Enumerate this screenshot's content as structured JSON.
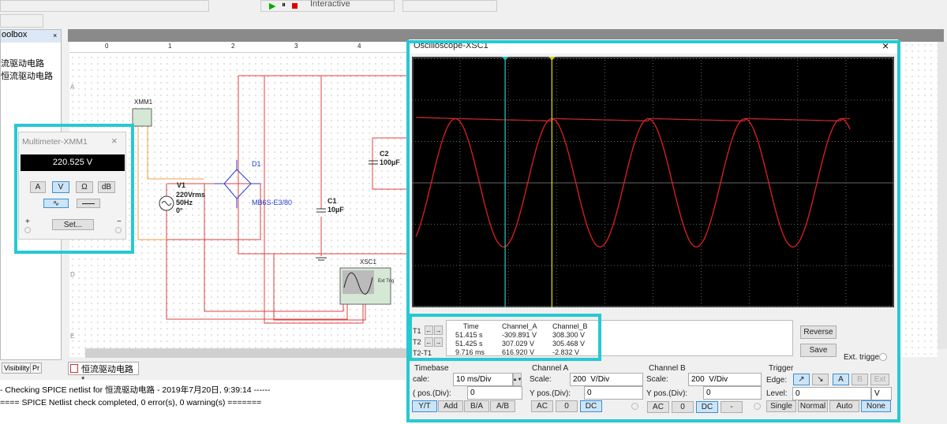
{
  "toolbar": {
    "sim_mode": "Interactive"
  },
  "toolbox": {
    "title": "oolbox",
    "items": [
      "流驱动电路",
      "恒流驱动电路"
    ],
    "tabs": [
      "Visibility",
      "Pr"
    ]
  },
  "ruler": {
    "cols": [
      "0",
      "1",
      "2",
      "3",
      "4"
    ],
    "rows": [
      "A",
      "D",
      "E"
    ]
  },
  "circuit": {
    "xmm": "XMM1",
    "d1": "D1",
    "d1_part": "MB6S-E3/80",
    "v1": "V1",
    "v1_v": "220Vrms",
    "v1_f": "50Hz",
    "v1_p": "0°",
    "c1": "C1",
    "c1_v": "10µF",
    "c2": "C2",
    "c2_v": "100µF",
    "xsc": "XSC1",
    "ext_trig": "Ext Trig"
  },
  "doc_tab": "恒流驱动电路 *",
  "log": [
    "- Checking SPICE netlist for 恒流驱动电路 - 2019年7月20日, 9:39:14 ------",
    "==== SPICE Netlist check completed, 0 error(s), 0 warning(s) ======="
  ],
  "multimeter": {
    "title": "Multimeter-XMM1",
    "reading": "220.525 V",
    "modes": [
      "A",
      "V",
      "Ω",
      "dB"
    ],
    "active_mode": "V",
    "set_label": "Set...",
    "plus": "+",
    "minus": "−"
  },
  "scope": {
    "title": "Oscilloscope-XSC1",
    "colors": {
      "channel_a": "#e02020",
      "channel_b": "#c02828",
      "t1": "#20c0c0",
      "t2": "#d0d020"
    },
    "trace": {
      "timebase_ms_per_div": 10,
      "volts_per_div": 200,
      "ch_a_amplitude_v": 310,
      "ch_a_freq_hz": 50,
      "ch_b_level_v": 305,
      "t1_div": 1.9,
      "t2_div": 2.87
    },
    "readout": {
      "headers": [
        "Time",
        "Channel_A",
        "Channel_B"
      ],
      "rows": [
        {
          "label": "T1",
          "time": "51.415 s",
          "a": "-309.891 V",
          "b": "308.300 V"
        },
        {
          "label": "T2",
          "time": "51.425 s",
          "a": "307.029 V",
          "b": "305.468 V"
        },
        {
          "label": "T2-T1",
          "time": "9.716 ms",
          "a": "616.920 V",
          "b": "-2.832 V"
        }
      ]
    },
    "reverse": "Reverse",
    "save": "Save",
    "ext_trigger": "Ext. trigger",
    "timebase": {
      "title": "Timebase",
      "scale_label": "cale:",
      "scale": "10 ms/Div",
      "xpos_label": "( pos.(Div):",
      "xpos": "0",
      "modes": [
        "Y/T",
        "Add",
        "B/A",
        "A/B"
      ],
      "active": "Y/T"
    },
    "channel_a": {
      "title": "Channel A",
      "scale_label": "Scale:",
      "scale": "200  V/Div",
      "ypos_label": "Y pos.(Div):",
      "ypos": "0",
      "coupling": [
        "AC",
        "0",
        "DC"
      ],
      "active": "DC"
    },
    "channel_b": {
      "title": "Channel B",
      "scale_label": "Scale:",
      "scale": "200  V/Div",
      "ypos_label": "Y pos.(Div):",
      "ypos": "0",
      "coupling": [
        "AC",
        "0",
        "DC",
        "-"
      ],
      "active": "DC"
    },
    "trigger": {
      "title": "Trigger",
      "edge_label": "Edge:",
      "edges": [
        "↗",
        "↘"
      ],
      "sources": [
        "A",
        "B",
        "Ext"
      ],
      "level_label": "Level:",
      "level": "0",
      "level_unit": "V",
      "modes": [
        "Single",
        "Normal",
        "Auto",
        "None"
      ],
      "active": "None"
    }
  }
}
